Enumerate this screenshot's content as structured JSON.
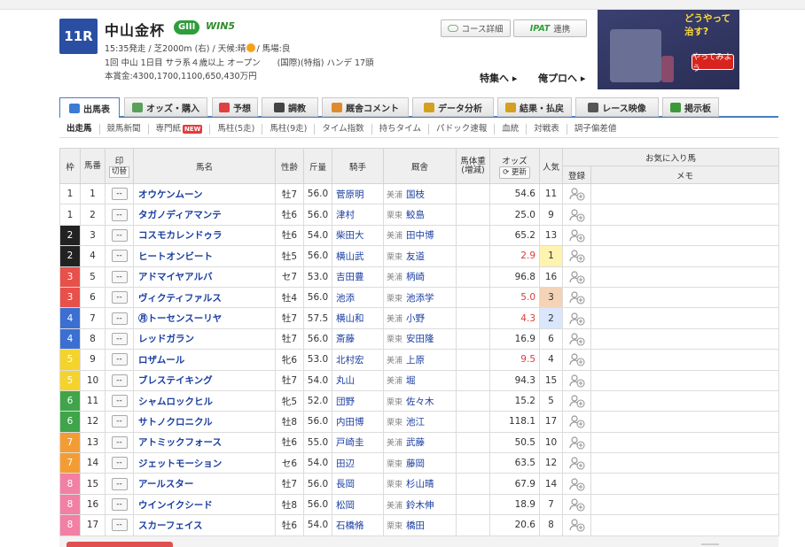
{
  "race": {
    "number": "11R",
    "name": "中山金杯",
    "grade": "GIII",
    "win5": "WIN5",
    "line1": "15:35発走 / 芝2000m (右) / 天候:晴",
    "line1b": "/ 馬場:良",
    "line2": "1回 中山 1日目 サラ系４歳以上 オープン　　(国際)(特指) ハンデ 17頭",
    "line3": "本賞金:4300,1700,1100,650,430万円"
  },
  "header_buttons": {
    "course": "コース詳細",
    "ipat_logo": "IPAT",
    "ipat_label": "連携",
    "special": "特集へ ▸",
    "orepro": "俺プロへ ▸"
  },
  "ad": {
    "question": "どうやって治す?",
    "button": "やってみよう"
  },
  "tabs": [
    {
      "label": "出馬表",
      "color": "#3b7bd6"
    },
    {
      "label": "オッズ・購入",
      "color": "#5aa05a"
    },
    {
      "label": "予想",
      "color": "#e04040"
    },
    {
      "label": "調教",
      "color": "#444"
    },
    {
      "label": "厩舎コメント",
      "color": "#e08a30"
    },
    {
      "label": "データ分析",
      "color": "#d4a020"
    },
    {
      "label": "結果・払戻",
      "color": "#d4a020"
    },
    {
      "label": "レース映像",
      "color": "#555"
    },
    {
      "label": "掲示板",
      "color": "#3a9a3a"
    }
  ],
  "subnav": [
    "出走馬",
    "競馬新聞",
    "専門紙",
    "馬柱(5走)",
    "馬柱(9走)",
    "タイム指数",
    "持ちタイム",
    "パドック速報",
    "血統",
    "対戦表",
    "調子偏差値"
  ],
  "subnav_new": "NEW",
  "table": {
    "h_waku": "枠",
    "h_umaban": "馬番",
    "h_mark": "印",
    "h_kirikae": "切替",
    "h_name": "馬名",
    "h_age": "性齢",
    "h_weight": "斤量",
    "h_jockey": "騎手",
    "h_trainer": "厩舎",
    "h_body": "馬体重",
    "h_body2": "(増減)",
    "h_odds": "オッズ",
    "h_update": "更新",
    "h_pop": "人気",
    "h_fav": "お気に入り馬",
    "h_reg": "登録",
    "h_memo": "メモ",
    "mark_text": "--"
  },
  "horses": [
    {
      "waku": "1",
      "num": "1",
      "name": "オウケンムーン",
      "age": "牡7",
      "kg": "56.0",
      "jockey": "菅原明",
      "loc": "美浦",
      "trainer": "国枝",
      "odds": "54.6",
      "pop": "11",
      "red": false,
      "popc": ""
    },
    {
      "waku": "1",
      "num": "2",
      "name": "タガノディアマンテ",
      "age": "牡6",
      "kg": "56.0",
      "jockey": "津村",
      "loc": "栗東",
      "trainer": "鮫島",
      "odds": "25.0",
      "pop": "9",
      "red": false,
      "popc": ""
    },
    {
      "waku": "2",
      "num": "3",
      "name": "コスモカレンドゥラ",
      "age": "牡6",
      "kg": "54.0",
      "jockey": "柴田大",
      "loc": "美浦",
      "trainer": "田中博",
      "odds": "65.2",
      "pop": "13",
      "red": false,
      "popc": ""
    },
    {
      "waku": "2",
      "num": "4",
      "name": "ヒートオンビート",
      "age": "牡5",
      "kg": "56.0",
      "jockey": "横山武",
      "loc": "栗東",
      "trainer": "友道",
      "odds": "2.9",
      "pop": "1",
      "red": true,
      "popc": "pop1"
    },
    {
      "waku": "3",
      "num": "5",
      "name": "アドマイヤアルバ",
      "age": "セ7",
      "kg": "53.0",
      "jockey": "吉田豊",
      "loc": "美浦",
      "trainer": "柄崎",
      "odds": "96.8",
      "pop": "16",
      "red": false,
      "popc": ""
    },
    {
      "waku": "3",
      "num": "6",
      "name": "ヴィクティファルス",
      "age": "牡4",
      "kg": "56.0",
      "jockey": "池添",
      "loc": "栗東",
      "trainer": "池添学",
      "odds": "5.0",
      "pop": "3",
      "red": true,
      "popc": "pop3"
    },
    {
      "waku": "4",
      "num": "7",
      "name": "㊊トーセンスーリヤ",
      "age": "牡7",
      "kg": "57.5",
      "jockey": "横山和",
      "loc": "美浦",
      "trainer": "小野",
      "odds": "4.3",
      "pop": "2",
      "red": true,
      "popc": "pop2"
    },
    {
      "waku": "4",
      "num": "8",
      "name": "レッドガラン",
      "age": "牡7",
      "kg": "56.0",
      "jockey": "斎藤",
      "loc": "栗東",
      "trainer": "安田隆",
      "odds": "16.9",
      "pop": "6",
      "red": false,
      "popc": ""
    },
    {
      "waku": "5",
      "num": "9",
      "name": "ロザムール",
      "age": "牝6",
      "kg": "53.0",
      "jockey": "北村宏",
      "loc": "美浦",
      "trainer": "上原",
      "odds": "9.5",
      "pop": "4",
      "red": true,
      "popc": ""
    },
    {
      "waku": "5",
      "num": "10",
      "name": "ブレステイキング",
      "age": "牡7",
      "kg": "54.0",
      "jockey": "丸山",
      "loc": "美浦",
      "trainer": "堀",
      "odds": "94.3",
      "pop": "15",
      "red": false,
      "popc": ""
    },
    {
      "waku": "6",
      "num": "11",
      "name": "シャムロックヒル",
      "age": "牝5",
      "kg": "52.0",
      "jockey": "団野",
      "loc": "栗東",
      "trainer": "佐々木",
      "odds": "15.2",
      "pop": "5",
      "red": false,
      "popc": ""
    },
    {
      "waku": "6",
      "num": "12",
      "name": "サトノクロニクル",
      "age": "牡8",
      "kg": "56.0",
      "jockey": "内田博",
      "loc": "栗東",
      "trainer": "池江",
      "odds": "118.1",
      "pop": "17",
      "red": false,
      "popc": ""
    },
    {
      "waku": "7",
      "num": "13",
      "name": "アトミックフォース",
      "age": "牡6",
      "kg": "55.0",
      "jockey": "戸崎圭",
      "loc": "美浦",
      "trainer": "武藤",
      "odds": "50.5",
      "pop": "10",
      "red": false,
      "popc": ""
    },
    {
      "waku": "7",
      "num": "14",
      "name": "ジェットモーション",
      "age": "セ6",
      "kg": "54.0",
      "jockey": "田辺",
      "loc": "栗東",
      "trainer": "藤岡",
      "odds": "63.5",
      "pop": "12",
      "red": false,
      "popc": ""
    },
    {
      "waku": "8",
      "num": "15",
      "name": "アールスター",
      "age": "牡7",
      "kg": "56.0",
      "jockey": "長岡",
      "loc": "栗東",
      "trainer": "杉山晴",
      "odds": "67.9",
      "pop": "14",
      "red": false,
      "popc": ""
    },
    {
      "waku": "8",
      "num": "16",
      "name": "ウインイクシード",
      "age": "牡8",
      "kg": "56.0",
      "jockey": "松岡",
      "loc": "美浦",
      "trainer": "鈴木伸",
      "odds": "18.9",
      "pop": "7",
      "red": false,
      "popc": ""
    },
    {
      "waku": "8",
      "num": "17",
      "name": "スカーフェイス",
      "age": "牡6",
      "kg": "54.0",
      "jockey": "石橋脩",
      "loc": "栗東",
      "trainer": "橋田",
      "odds": "20.6",
      "pop": "8",
      "red": false,
      "popc": ""
    }
  ]
}
